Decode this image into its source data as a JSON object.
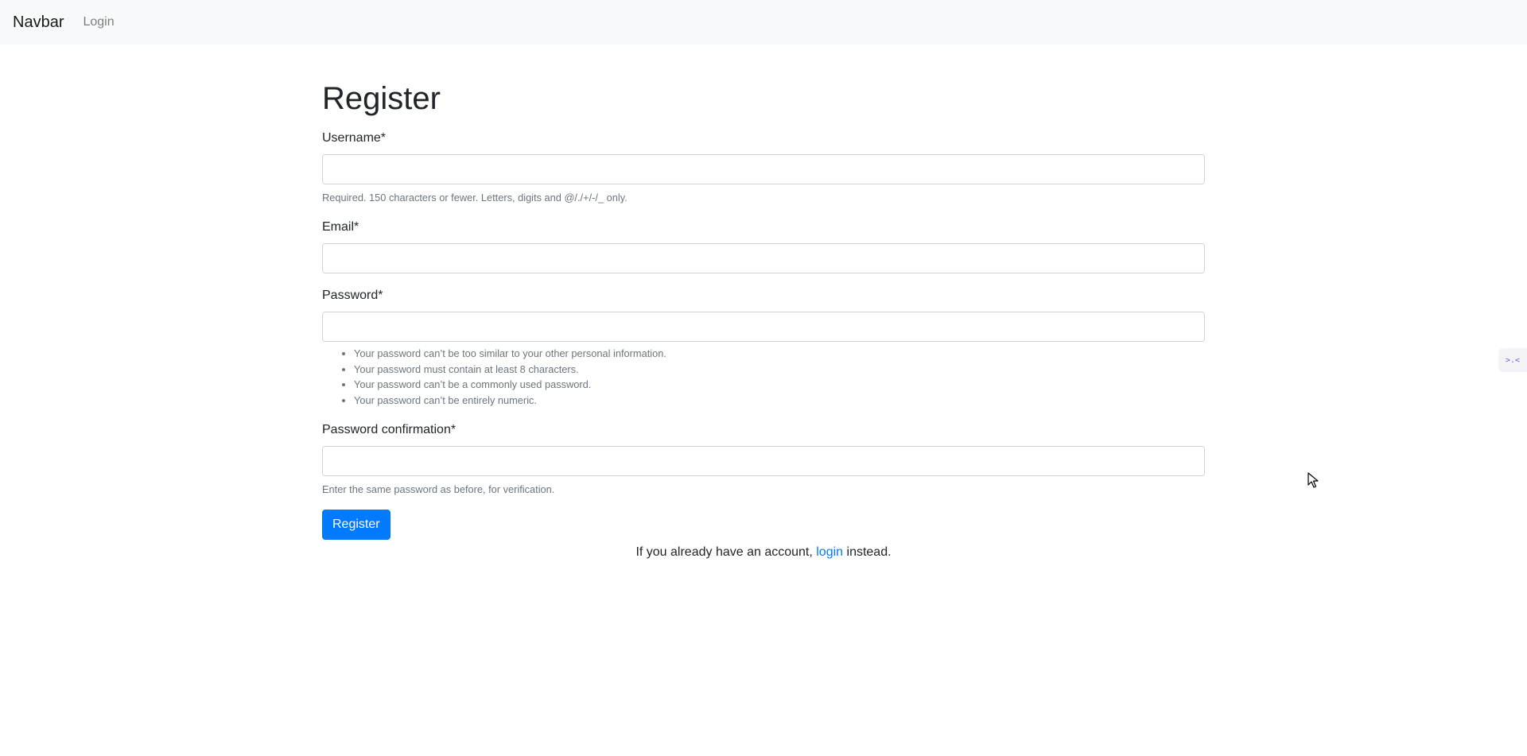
{
  "navbar": {
    "brand": "Navbar",
    "links": [
      {
        "label": "Login"
      }
    ]
  },
  "page": {
    "title": "Register"
  },
  "form": {
    "username": {
      "label": "Username*",
      "value": "",
      "help": "Required. 150 characters or fewer. Letters, digits and @/./+/-/_ only."
    },
    "email": {
      "label": "Email*",
      "value": ""
    },
    "password": {
      "label": "Password*",
      "value": "",
      "help_items": [
        "Your password can’t be too similar to your other personal information.",
        "Your password must contain at least 8 characters.",
        "Your password can’t be a commonly used password.",
        "Your password can’t be entirely numeric."
      ]
    },
    "password_confirmation": {
      "label": "Password confirmation*",
      "value": "",
      "help": "Enter the same password as before, for verification."
    },
    "submit_label": "Register"
  },
  "footer": {
    "prefix": "If you already have an account, ",
    "link": "login",
    "suffix": " instead."
  },
  "side_widget": {
    "icon": "code-expand-icon",
    "glyph": ">.<"
  },
  "colors": {
    "primary": "#007bff",
    "navbar_bg": "#f8f9fa",
    "muted": "#6c757d"
  }
}
